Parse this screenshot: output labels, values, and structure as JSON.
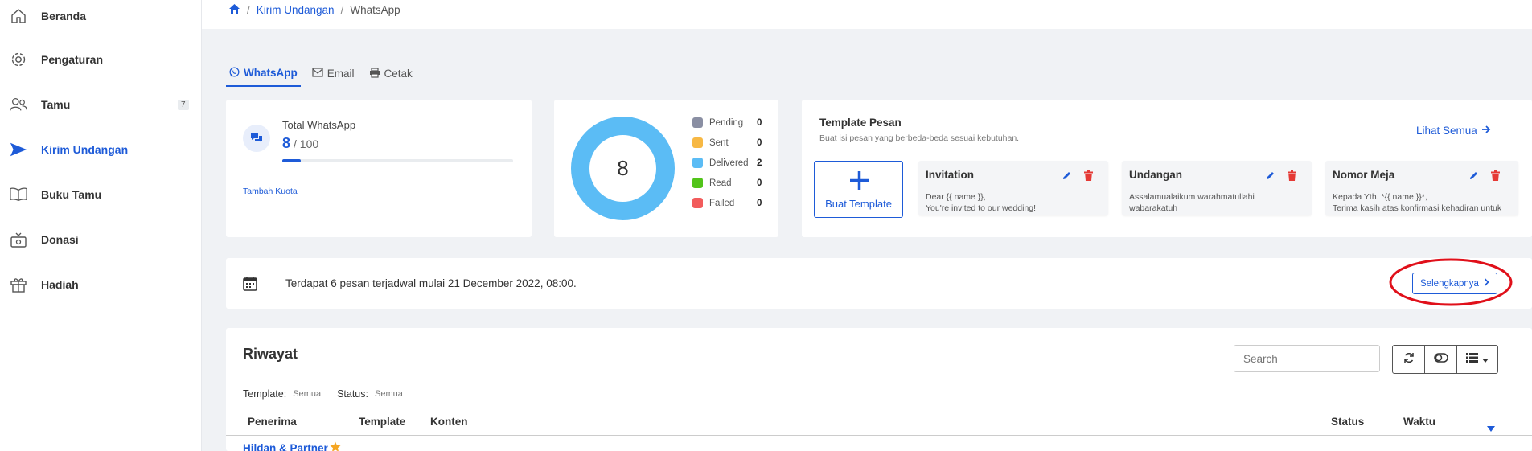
{
  "sidebar": {
    "items": [
      {
        "label": "Beranda",
        "icon": "home-icon"
      },
      {
        "label": "Pengaturan",
        "icon": "gear-icon"
      },
      {
        "label": "Tamu",
        "icon": "users-icon",
        "badge": "7"
      },
      {
        "label": "Kirim Undangan",
        "icon": "send-icon",
        "active": true
      },
      {
        "label": "Buku Tamu",
        "icon": "book-icon"
      },
      {
        "label": "Donasi",
        "icon": "donation-icon"
      },
      {
        "label": "Hadiah",
        "icon": "gift-icon"
      }
    ]
  },
  "breadcrumb": {
    "home_icon": "home-icon",
    "item1": "Kirim Undangan",
    "item2": "WhatsApp"
  },
  "tabs": [
    {
      "label": "WhatsApp",
      "icon": "whatsapp-icon",
      "active": true
    },
    {
      "label": "Email",
      "icon": "envelope-icon"
    },
    {
      "label": "Cetak",
      "icon": "printer-icon"
    }
  ],
  "quota": {
    "title": "Total WhatsApp",
    "used": "8",
    "total": "/ 100",
    "progress_fraction": 0.08,
    "link": "Tambah Kuota"
  },
  "status_chart": {
    "center_value": "8",
    "legend": [
      {
        "label": "Pending",
        "value": "0",
        "color": "#8a8fa3"
      },
      {
        "label": "Sent",
        "value": "0",
        "color": "#f7b844"
      },
      {
        "label": "Delivered",
        "value": "2",
        "color": "#5bbcf5"
      },
      {
        "label": "Read",
        "value": "0",
        "color": "#52c41a"
      },
      {
        "label": "Failed",
        "value": "0",
        "color": "#f25c5c"
      }
    ]
  },
  "templates": {
    "title": "Template Pesan",
    "subtitle": "Buat isi pesan yang berbeda-beda sesuai kebutuhan.",
    "see_all": "Lihat Semua",
    "create_label": "Buat Template",
    "items": [
      {
        "title": "Invitation",
        "body": "Dear {{ name }},\nYou're invited to our wedding!"
      },
      {
        "title": "Undangan",
        "body": "Assalamualaikum warahmatullahi\nwabarakatuh"
      },
      {
        "title": "Nomor Meja",
        "body": "Kepada Yth. *{{ name }}*,\nTerima kasih atas konfirmasi kehadiran untuk"
      }
    ]
  },
  "schedule": {
    "text": "Terdapat 6 pesan terjadwal mulai 21 December 2022, 08:00.",
    "button": "Selengkapnya"
  },
  "history": {
    "title": "Riwayat",
    "search_placeholder": "Search",
    "filter_template_label": "Template:",
    "filter_template_value": "Semua",
    "filter_status_label": "Status:",
    "filter_status_value": "Semua",
    "columns": [
      "Penerima",
      "Template",
      "Konten",
      "Status",
      "Waktu"
    ],
    "first_row_recipient": "Hildan & Partner"
  },
  "colors": {
    "accent": "#1e5bd8",
    "annotation": "#e0101a"
  }
}
